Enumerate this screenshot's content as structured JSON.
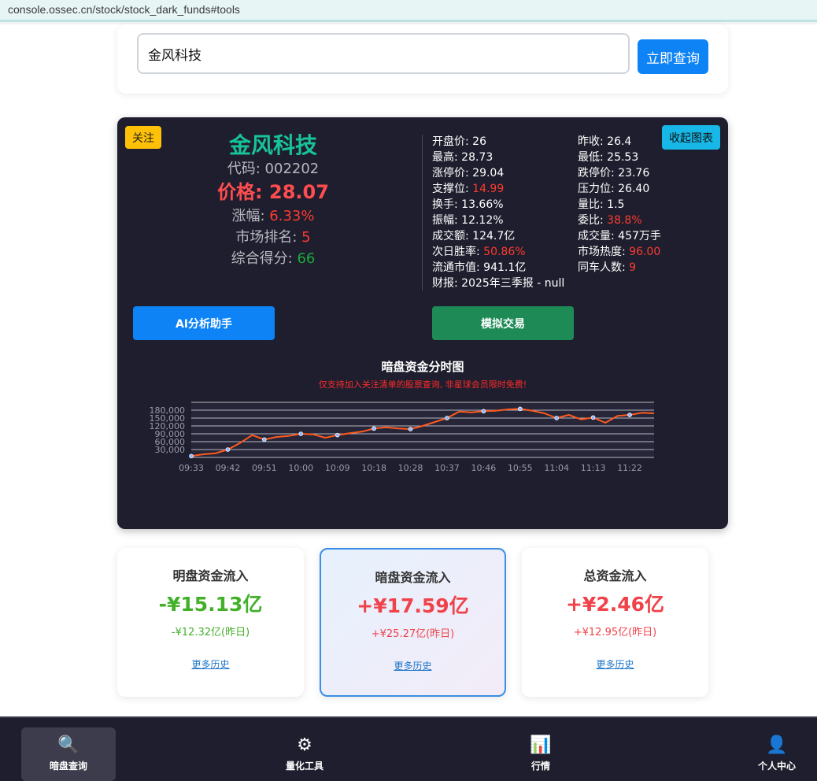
{
  "browser": {
    "url": "console.ossec.cn/stock/stock_dark_funds#tools"
  },
  "search": {
    "value": "金风科技",
    "button_label": "立即查询"
  },
  "stock": {
    "follow_label": "关注",
    "collapse_label": "收起图表",
    "name": "金风科技",
    "code_text": "代码: 002202",
    "price_text": "价格: 28.07",
    "change_label": "涨幅: ",
    "change_value": "6.33%",
    "rank_label": "市场排名: ",
    "rank_value": "5",
    "score_label": "综合得分: ",
    "score_value": "66",
    "metrics": [
      {
        "label": "开盘价: ",
        "value": "26",
        "red": false
      },
      {
        "label": "昨收: ",
        "value": "26.4",
        "red": false
      },
      {
        "label": "最高: ",
        "value": "28.73",
        "red": false
      },
      {
        "label": "最低: ",
        "value": "25.53",
        "red": false
      },
      {
        "label": "涨停价: ",
        "value": "29.04",
        "red": false
      },
      {
        "label": "跌停价: ",
        "value": "23.76",
        "red": false
      },
      {
        "label": "支撑位: ",
        "value": "14.99",
        "red": true
      },
      {
        "label": "压力位: ",
        "value": "26.40",
        "red": false
      },
      {
        "label": "换手: ",
        "value": "13.66%",
        "red": false
      },
      {
        "label": "量比: ",
        "value": "1.5",
        "red": false
      },
      {
        "label": "振幅: ",
        "value": "12.12%",
        "red": false
      },
      {
        "label": "委比: ",
        "value": "38.8%",
        "red": true
      },
      {
        "label": "成交额: ",
        "value": "124.7亿",
        "red": false
      },
      {
        "label": "成交量: ",
        "value": "457万手",
        "red": false
      },
      {
        "label": "次日胜率: ",
        "value": "50.86%",
        "red": true
      },
      {
        "label": "市场热度: ",
        "value": "96.00",
        "red": true
      },
      {
        "label": "流通市值: ",
        "value": "941.1亿",
        "red": false
      },
      {
        "label": "同车人数: ",
        "value": "9",
        "red": true
      },
      {
        "label": "财报: ",
        "value": "2025年三季报 - null",
        "red": false
      }
    ],
    "ai_button": "AI分析助手",
    "trade_button": "模拟交易"
  },
  "chart_data": {
    "type": "line",
    "title": "暗盘资金分时图",
    "subtitle": "仅支持加入关注清单的股票查询, 非星球会员限时免费!",
    "xlabel": "",
    "ylabel": "",
    "ylim": [
      0,
      210000
    ],
    "grid": true,
    "yticks": [
      30000,
      60000,
      90000,
      120000,
      150000,
      180000
    ],
    "ytick_labels": [
      "30,000",
      "60,000",
      "90,000",
      "120,000",
      "150,000",
      "180,000"
    ],
    "xticks": [
      "09:33",
      "09:42",
      "09:51",
      "10:00",
      "10:09",
      "10:18",
      "10:28",
      "10:37",
      "10:46",
      "10:55",
      "11:04",
      "11:13",
      "11:22"
    ],
    "series": [
      {
        "color": "#ff5a1f",
        "marker_color": "#8ab4ff",
        "x": [
          "09:33",
          "09:36",
          "09:39",
          "09:42",
          "09:45",
          "09:48",
          "09:51",
          "09:54",
          "09:57",
          "10:00",
          "10:03",
          "10:06",
          "10:09",
          "10:12",
          "10:15",
          "10:18",
          "10:21",
          "10:24",
          "10:28",
          "10:31",
          "10:34",
          "10:37",
          "10:40",
          "10:43",
          "10:46",
          "10:49",
          "10:52",
          "10:55",
          "10:58",
          "11:01",
          "11:04",
          "11:07",
          "11:10",
          "11:13",
          "11:16",
          "11:19",
          "11:22",
          "11:25",
          "11:28"
        ],
        "values": [
          5000,
          12000,
          16000,
          30000,
          55000,
          85000,
          68000,
          78000,
          82000,
          90000,
          88000,
          75000,
          85000,
          92000,
          98000,
          110000,
          115000,
          110000,
          108000,
          120000,
          135000,
          150000,
          175000,
          172000,
          176000,
          178000,
          183000,
          185000,
          178000,
          168000,
          150000,
          162000,
          145000,
          152000,
          132000,
          158000,
          162000,
          170000,
          168000
        ],
        "markers": [
          5000,
          30000,
          68000,
          90000,
          85000,
          110000,
          108000,
          150000,
          176000,
          185000,
          150000,
          152000,
          162000
        ]
      }
    ]
  },
  "flows": [
    {
      "title": "明盘资金流入",
      "value": "-¥15.13亿",
      "prev": "-¥12.32亿(昨日)",
      "more": "更多历史",
      "sign": "neg",
      "active": false
    },
    {
      "title": "暗盘资金流入",
      "value": "+¥17.59亿",
      "prev": "+¥25.27亿(昨日)",
      "more": "更多历史",
      "sign": "pos",
      "active": true
    },
    {
      "title": "总资金流入",
      "value": "+¥2.46亿",
      "prev": "+¥12.95亿(昨日)",
      "more": "更多历史",
      "sign": "pos",
      "active": false
    }
  ],
  "nav": [
    {
      "label": "暗盘查询",
      "icon": "magnifier-icon",
      "glyph": "🔍",
      "active": true
    },
    {
      "label": "量化工具",
      "icon": "gear-icon",
      "glyph": "⚙",
      "active": false
    },
    {
      "label": "行情",
      "icon": "bar-chart-icon",
      "glyph": "📊",
      "active": false
    },
    {
      "label": "个人中心",
      "icon": "user-icon",
      "glyph": "👤",
      "active": false
    }
  ]
}
